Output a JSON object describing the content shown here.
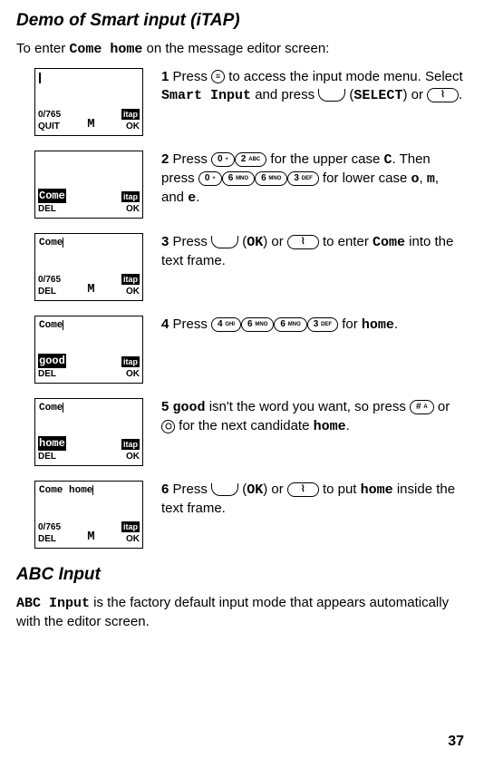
{
  "title_demo": "Demo of Smart input (iTAP)",
  "intro_before": "To enter ",
  "intro_code": "Come home",
  "intro_after": " on the message editor screen:",
  "screens": {
    "s1": {
      "counter": "0/765",
      "left": "QUIT",
      "center": "M",
      "badge": "itap",
      "right": "OK"
    },
    "s2": {
      "hl": "Come",
      "left": "DEL",
      "badge": "itap",
      "right": "OK"
    },
    "s3": {
      "line": "Come",
      "counter": "0/765",
      "left": "DEL",
      "center": "M",
      "badge": "itap",
      "right": "OK"
    },
    "s4": {
      "line": "Come",
      "hl": "good",
      "left": "DEL",
      "badge": "itap",
      "right": "OK"
    },
    "s5": {
      "line": "Come",
      "hl": "home",
      "left": "DEL",
      "badge": "itap",
      "right": "OK"
    },
    "s6": {
      "line": "Come home",
      "counter": "0/765",
      "left": "DEL",
      "center": "M",
      "badge": "itap",
      "right": "OK"
    }
  },
  "steps": {
    "n1": "1",
    "t1a": " Press ",
    "t1b": " to access the input mode menu. Select ",
    "t1c": "Smart Input",
    "t1d": " and press ",
    "t1e": " (",
    "t1f": "SELECT",
    "t1g": ") or ",
    "t1h": ".",
    "n2": "2",
    "t2a": " Press ",
    "k0": "0",
    "k0s": "+",
    "k2": "2",
    "k2s": "ABC",
    "t2b": " for the upper case ",
    "t2c": "C",
    "t2d": ". Then press ",
    "k6": "6",
    "k6s": "MNO",
    "k3": "3",
    "k3s": "DEF",
    "t2e": " for lower case ",
    "t2f": "o",
    "t2g": ", ",
    "t2h": "m",
    "t2i": ", and ",
    "t2j": "e",
    "t2k": ".",
    "n3": "3",
    "t3a": " Press ",
    "t3b": " (",
    "t3c": "OK",
    "t3d": ") or ",
    "t3e": " to enter ",
    "t3f": "Come",
    "t3g": " into the text frame.",
    "n4": "4",
    "t4a": " Press ",
    "k4": "4",
    "k4s": "GHI",
    "t4b": " for ",
    "t4c": "home",
    "t4d": ".",
    "n5": "5",
    "t5a": " ",
    "t5b": "good",
    "t5c": " isn't the word you want, so press ",
    "kpound": "#",
    "kpounds": "A",
    "t5d": " or ",
    "t5e": " for the next candidate ",
    "t5f": "home",
    "t5g": ".",
    "n6": "6",
    "t6a": " Press ",
    "t6b": " (",
    "t6c": "OK",
    "t6d": ") or ",
    "t6e": " to put ",
    "t6f": "home",
    "t6g": " inside the text frame."
  },
  "title_abc": "ABC Input",
  "abc_code": "ABC Input",
  "abc_text": " is the factory default input mode that appears automatically with the editor screen.",
  "page": "37"
}
